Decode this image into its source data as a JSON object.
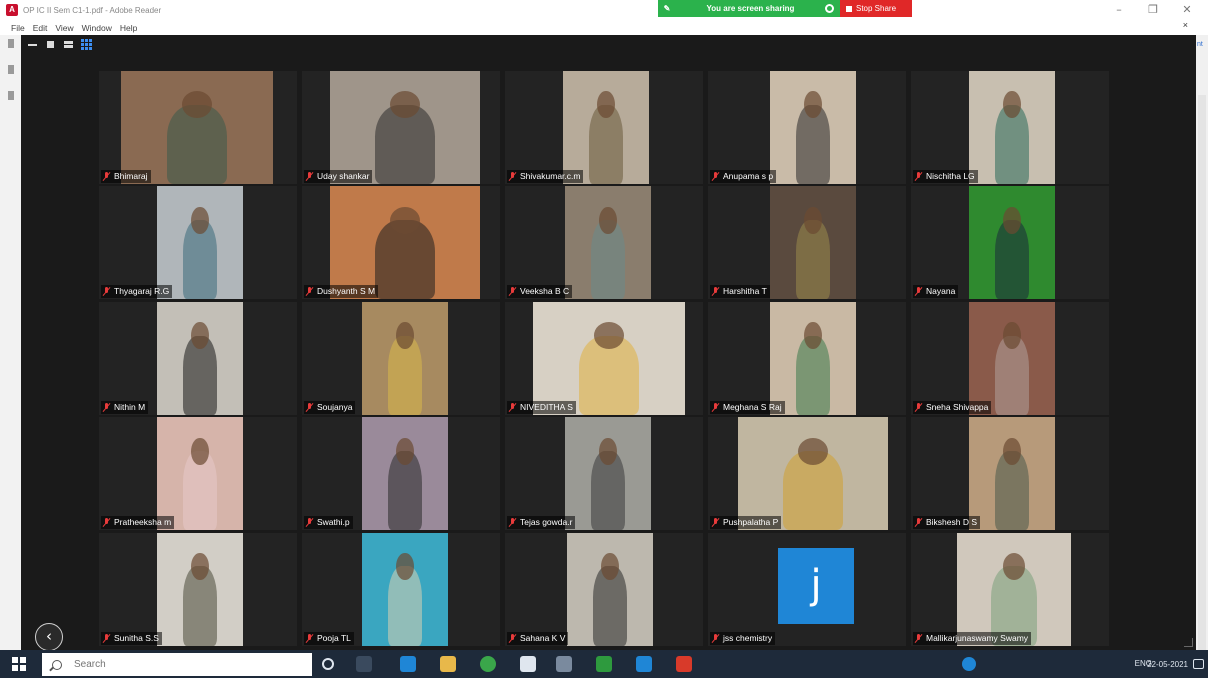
{
  "titlebar": {
    "title": "OP IC II Sem C1-1.pdf - Adobe Reader",
    "minimize": "–",
    "restore": "❐",
    "close": "✕"
  },
  "menubar": {
    "items": [
      "File",
      "Edit",
      "View",
      "Window",
      "Help"
    ],
    "close": "×"
  },
  "share_banner": {
    "status": "You are screen sharing",
    "stop_label": "Stop Share",
    "status_color": "#2bb24c",
    "stop_color": "#e02828"
  },
  "adobe_right": {
    "edge_text": "nt"
  },
  "participants": [
    {
      "name": "Bhimaraj",
      "muted": true,
      "bg": "#8a6a52",
      "person": "#3a5a4a"
    },
    {
      "name": "Uday shankar",
      "muted": true,
      "bg": "#9f958a",
      "person": "#2c2c2c"
    },
    {
      "name": "Shivakumar.c.m",
      "muted": true,
      "bg": "#b7ab9a",
      "person": "#6a5a3a"
    },
    {
      "name": "Anupama s p",
      "muted": true,
      "bg": "#c9bba8",
      "person": "#2a2a2a"
    },
    {
      "name": "Nischitha LG",
      "muted": true,
      "bg": "#c8bfb0",
      "person": "#2a6a5a"
    },
    {
      "name": "Thyagaraj R.G",
      "muted": true,
      "bg": "#b0b6ba",
      "person": "#3a6a7a"
    },
    {
      "name": "Dushyanth S M",
      "muted": true,
      "bg": "#c07a4a",
      "person": "#1f1f1f"
    },
    {
      "name": "Veeksha B C",
      "muted": true,
      "bg": "#8a7d6d",
      "person": "#6a8a8a"
    },
    {
      "name": "Harshitha T",
      "muted": true,
      "bg": "#5a4a3e",
      "person": "#9a8a4a"
    },
    {
      "name": "Nayana",
      "muted": true,
      "bg": "#2f8a2f",
      "person": "#1a2a3a"
    },
    {
      "name": "Nithin M",
      "muted": true,
      "bg": "#c3bfb7",
      "person": "#1a1a1a"
    },
    {
      "name": "Soujanya",
      "muted": true,
      "bg": "#a78a60",
      "person": "#d8b84a"
    },
    {
      "name": "NIVEDITHA S",
      "muted": true,
      "bg": "#d7d0c4",
      "person": "#e0b040"
    },
    {
      "name": "Meghana S Raj",
      "muted": true,
      "bg": "#c9b9a4",
      "person": "#3a7a4a"
    },
    {
      "name": "Sneha Shivappa",
      "muted": true,
      "bg": "#8a5a4a",
      "person": "#b0a09a"
    },
    {
      "name": "Pratheeksha m",
      "muted": true,
      "bg": "#d6b4aa",
      "person": "#e8c8c8"
    },
    {
      "name": "Swathi.p",
      "muted": true,
      "bg": "#9a8a9a",
      "person": "#2a2a2a"
    },
    {
      "name": "Tejas gowda.r",
      "muted": true,
      "bg": "#9a9a94",
      "person": "#3a3a3a"
    },
    {
      "name": "Pushpalatha P",
      "muted": true,
      "bg": "#c0b6a0",
      "person": "#d0a030"
    },
    {
      "name": "Bikshesh D S",
      "muted": true,
      "bg": "#b79a7a",
      "person": "#4a5a4a"
    },
    {
      "name": "Sunitha S.S",
      "muted": true,
      "bg": "#d2cec6",
      "person": "#4a4a3a"
    },
    {
      "name": "Pooja TL",
      "muted": true,
      "bg": "#3aa6c0",
      "person": "#d8d0b0"
    },
    {
      "name": "Sahana K V",
      "muted": true,
      "bg": "#bdb8ae",
      "person": "#2a2a2a"
    },
    {
      "name": "jss chemistry",
      "muted": true,
      "avatar_letter": "j",
      "avatar_color": "#1f86d6"
    },
    {
      "name": "Mallikarjunaswamy Swamy",
      "muted": true,
      "bg": "#d0c8bc",
      "person": "#7aa07a"
    }
  ],
  "zoom_controls": {
    "back": "‹"
  },
  "taskbar": {
    "search_placeholder": "Search",
    "tray_text": "ENG",
    "date": "22-05-2021"
  }
}
